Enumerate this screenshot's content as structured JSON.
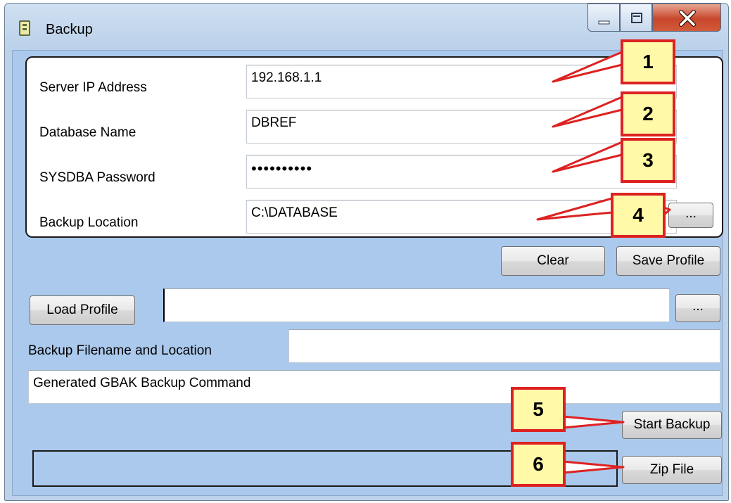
{
  "window": {
    "title": "Backup",
    "icon": "database-icon"
  },
  "controls": {
    "minimize": "minimize-icon",
    "maximize": "maximize-icon",
    "close": "close-icon"
  },
  "form": {
    "server_ip": {
      "label": "Server IP Address",
      "value": "192.168.1.1"
    },
    "database_name": {
      "label": "Database Name",
      "value": "DBREF"
    },
    "password": {
      "label": "SYSDBA Password",
      "value": "••••••••••"
    },
    "backup_location": {
      "label": "Backup Location",
      "value": "C:\\DATABASE",
      "browse_label": "..."
    }
  },
  "buttons": {
    "clear": "Clear",
    "save_profile": "Save Profile",
    "load_profile": "Load Profile",
    "profile_browse": "...",
    "start_backup": "Start Backup",
    "zip_file": "Zip File"
  },
  "profile_path": {
    "value": ""
  },
  "backup_filename": {
    "label": "Backup Filename and Location",
    "value": ""
  },
  "command": {
    "value": "Generated GBAK Backup Command"
  },
  "callouts": [
    "1",
    "2",
    "3",
    "4",
    "5",
    "6"
  ],
  "colors": {
    "client_bg": "#abc9ec",
    "callout_fill": "#fff9a8",
    "callout_border": "#dd2222"
  }
}
